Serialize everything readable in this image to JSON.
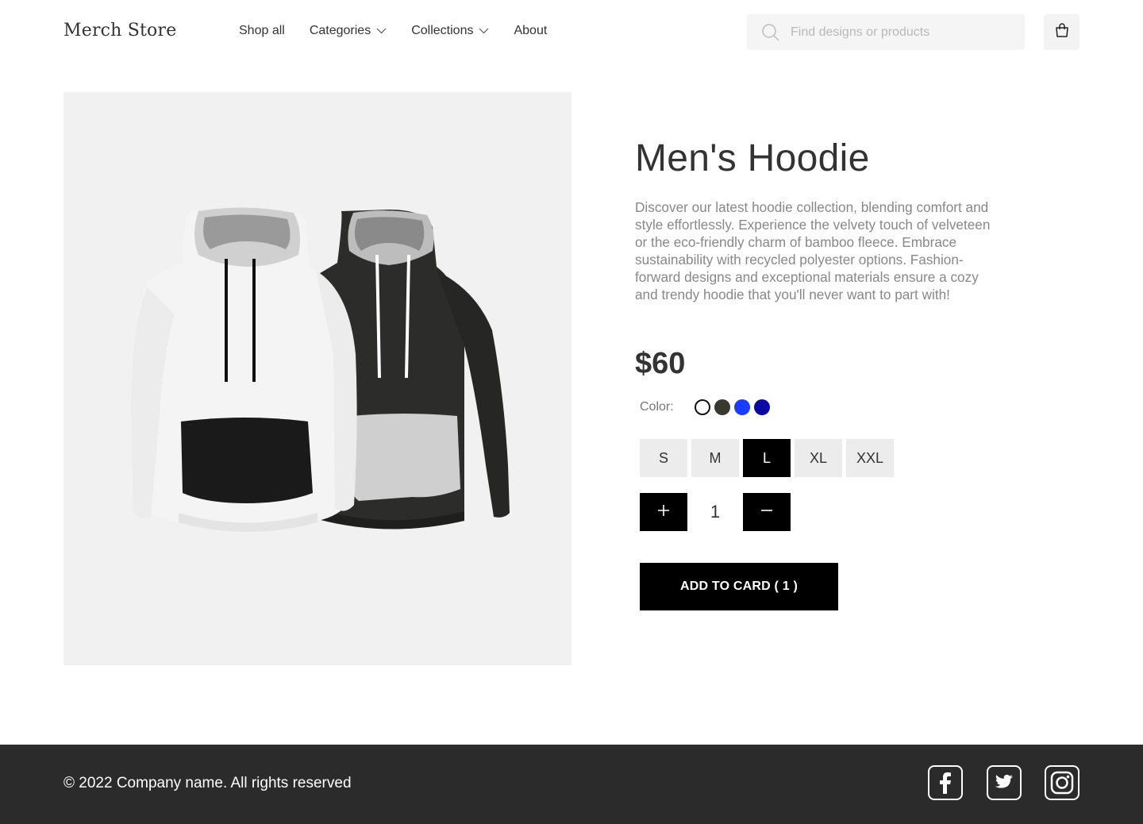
{
  "header": {
    "logo": "Merch Store",
    "nav": [
      {
        "label": "Shop all",
        "has_dropdown": false
      },
      {
        "label": "Categories",
        "has_dropdown": true
      },
      {
        "label": "Collections",
        "has_dropdown": true
      },
      {
        "label": "About",
        "has_dropdown": false
      }
    ],
    "search_placeholder": "Find designs or products",
    "search_icon": "search-icon",
    "cart_icon": "shopping-bag-icon"
  },
  "product": {
    "image": "hoodies-white-and-black",
    "title": "Men's Hoodie",
    "description": "Discover our latest hoodie collection, blending comfort and style effortlessly. Experience the velvety touch of velveteen or the eco-friendly charm of bamboo fleece. Embrace sustainability with recycled polyester options. Fashion-forward designs and exceptional materials ensure a cozy and trendy hoodie that you'll never want to part with!",
    "price": "$60",
    "color_label": "Color:",
    "colors": [
      "#ffffff",
      "#383830",
      "#1a3cff",
      "#0a0aa0"
    ],
    "selected_color_index": 0,
    "sizes": [
      "S",
      "M",
      "L",
      "XL",
      "XXL"
    ],
    "selected_size": "L",
    "quantity": "1",
    "add_to_cart_label": "ADD TO CARD ( 1 )"
  },
  "footer": {
    "copyright": "© 2022 Company name. All rights reserved",
    "social": [
      "facebook-icon",
      "twitter-icon",
      "instagram-icon"
    ]
  }
}
